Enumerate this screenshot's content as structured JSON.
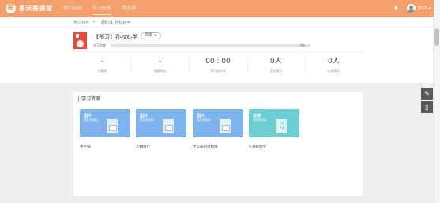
{
  "header": {
    "logo_mark": "易",
    "logo_text": "易沃易课堂",
    "nav": [
      {
        "label": "我的知识",
        "active": false
      },
      {
        "label": "学习任务",
        "active": true
      },
      {
        "label": "我的课",
        "active": false
      }
    ],
    "user_name": "李XX",
    "caret": "▾",
    "bell_icon": "bell-icon"
  },
  "breadcrumb": {
    "items": [
      "学习任务",
      ">",
      "【预习】孙权劝学"
    ]
  },
  "course": {
    "thumb_color": "#e14c3c",
    "title": "【预习】孙权劝学",
    "guide_label": "导学 >",
    "progress_label": "学习进度",
    "progress_value": 0,
    "progress_pct": "0%"
  },
  "stats": [
    {
      "value": "-",
      "label": "正确率"
    },
    {
      "value": "-",
      "label": "答题时长"
    },
    {
      "value": "00 : 00",
      "label": "预习总时长"
    },
    {
      "value": "0人",
      "label": "正在预习"
    },
    {
      "value": "0人",
      "label": "完成预习"
    }
  ],
  "resources": {
    "title": "学习资源",
    "items": [
      {
        "type": "图片",
        "sub": "图片资源库",
        "name": "生字词",
        "color": "blue"
      },
      {
        "type": "图片",
        "sub": "图片资源库",
        "name": "人物简介",
        "color": "blue"
      },
      {
        "type": "图片",
        "sub": "图片资源库",
        "name": "文言知识点梳理",
        "color": "blue"
      },
      {
        "type": "音频",
        "sub": "音频资源库",
        "name": "4.孙权劝学",
        "color": "teal"
      }
    ]
  },
  "tools": {
    "edit_icon": "✎",
    "trash_icon": "🗑"
  },
  "colors": {
    "header": "#f5a06b",
    "accent": "#f08a4b",
    "card_blue": "#7fb3ec",
    "card_teal": "#6ccdd2"
  }
}
